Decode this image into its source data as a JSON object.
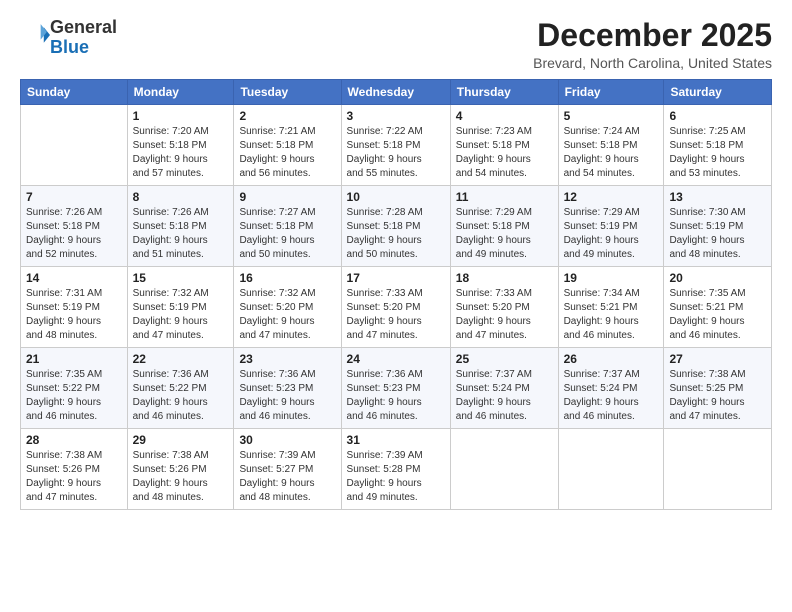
{
  "header": {
    "logo_line1": "General",
    "logo_line2": "Blue",
    "month": "December 2025",
    "location": "Brevard, North Carolina, United States"
  },
  "weekdays": [
    "Sunday",
    "Monday",
    "Tuesday",
    "Wednesday",
    "Thursday",
    "Friday",
    "Saturday"
  ],
  "weeks": [
    [
      {
        "day": "",
        "info": ""
      },
      {
        "day": "1",
        "info": "Sunrise: 7:20 AM\nSunset: 5:18 PM\nDaylight: 9 hours\nand 57 minutes."
      },
      {
        "day": "2",
        "info": "Sunrise: 7:21 AM\nSunset: 5:18 PM\nDaylight: 9 hours\nand 56 minutes."
      },
      {
        "day": "3",
        "info": "Sunrise: 7:22 AM\nSunset: 5:18 PM\nDaylight: 9 hours\nand 55 minutes."
      },
      {
        "day": "4",
        "info": "Sunrise: 7:23 AM\nSunset: 5:18 PM\nDaylight: 9 hours\nand 54 minutes."
      },
      {
        "day": "5",
        "info": "Sunrise: 7:24 AM\nSunset: 5:18 PM\nDaylight: 9 hours\nand 54 minutes."
      },
      {
        "day": "6",
        "info": "Sunrise: 7:25 AM\nSunset: 5:18 PM\nDaylight: 9 hours\nand 53 minutes."
      }
    ],
    [
      {
        "day": "7",
        "info": "Sunrise: 7:26 AM\nSunset: 5:18 PM\nDaylight: 9 hours\nand 52 minutes."
      },
      {
        "day": "8",
        "info": "Sunrise: 7:26 AM\nSunset: 5:18 PM\nDaylight: 9 hours\nand 51 minutes."
      },
      {
        "day": "9",
        "info": "Sunrise: 7:27 AM\nSunset: 5:18 PM\nDaylight: 9 hours\nand 50 minutes."
      },
      {
        "day": "10",
        "info": "Sunrise: 7:28 AM\nSunset: 5:18 PM\nDaylight: 9 hours\nand 50 minutes."
      },
      {
        "day": "11",
        "info": "Sunrise: 7:29 AM\nSunset: 5:18 PM\nDaylight: 9 hours\nand 49 minutes."
      },
      {
        "day": "12",
        "info": "Sunrise: 7:29 AM\nSunset: 5:19 PM\nDaylight: 9 hours\nand 49 minutes."
      },
      {
        "day": "13",
        "info": "Sunrise: 7:30 AM\nSunset: 5:19 PM\nDaylight: 9 hours\nand 48 minutes."
      }
    ],
    [
      {
        "day": "14",
        "info": "Sunrise: 7:31 AM\nSunset: 5:19 PM\nDaylight: 9 hours\nand 48 minutes."
      },
      {
        "day": "15",
        "info": "Sunrise: 7:32 AM\nSunset: 5:19 PM\nDaylight: 9 hours\nand 47 minutes."
      },
      {
        "day": "16",
        "info": "Sunrise: 7:32 AM\nSunset: 5:20 PM\nDaylight: 9 hours\nand 47 minutes."
      },
      {
        "day": "17",
        "info": "Sunrise: 7:33 AM\nSunset: 5:20 PM\nDaylight: 9 hours\nand 47 minutes."
      },
      {
        "day": "18",
        "info": "Sunrise: 7:33 AM\nSunset: 5:20 PM\nDaylight: 9 hours\nand 47 minutes."
      },
      {
        "day": "19",
        "info": "Sunrise: 7:34 AM\nSunset: 5:21 PM\nDaylight: 9 hours\nand 46 minutes."
      },
      {
        "day": "20",
        "info": "Sunrise: 7:35 AM\nSunset: 5:21 PM\nDaylight: 9 hours\nand 46 minutes."
      }
    ],
    [
      {
        "day": "21",
        "info": "Sunrise: 7:35 AM\nSunset: 5:22 PM\nDaylight: 9 hours\nand 46 minutes."
      },
      {
        "day": "22",
        "info": "Sunrise: 7:36 AM\nSunset: 5:22 PM\nDaylight: 9 hours\nand 46 minutes."
      },
      {
        "day": "23",
        "info": "Sunrise: 7:36 AM\nSunset: 5:23 PM\nDaylight: 9 hours\nand 46 minutes."
      },
      {
        "day": "24",
        "info": "Sunrise: 7:36 AM\nSunset: 5:23 PM\nDaylight: 9 hours\nand 46 minutes."
      },
      {
        "day": "25",
        "info": "Sunrise: 7:37 AM\nSunset: 5:24 PM\nDaylight: 9 hours\nand 46 minutes."
      },
      {
        "day": "26",
        "info": "Sunrise: 7:37 AM\nSunset: 5:24 PM\nDaylight: 9 hours\nand 46 minutes."
      },
      {
        "day": "27",
        "info": "Sunrise: 7:38 AM\nSunset: 5:25 PM\nDaylight: 9 hours\nand 47 minutes."
      }
    ],
    [
      {
        "day": "28",
        "info": "Sunrise: 7:38 AM\nSunset: 5:26 PM\nDaylight: 9 hours\nand 47 minutes."
      },
      {
        "day": "29",
        "info": "Sunrise: 7:38 AM\nSunset: 5:26 PM\nDaylight: 9 hours\nand 48 minutes."
      },
      {
        "day": "30",
        "info": "Sunrise: 7:39 AM\nSunset: 5:27 PM\nDaylight: 9 hours\nand 48 minutes."
      },
      {
        "day": "31",
        "info": "Sunrise: 7:39 AM\nSunset: 5:28 PM\nDaylight: 9 hours\nand 49 minutes."
      },
      {
        "day": "",
        "info": ""
      },
      {
        "day": "",
        "info": ""
      },
      {
        "day": "",
        "info": ""
      }
    ]
  ]
}
